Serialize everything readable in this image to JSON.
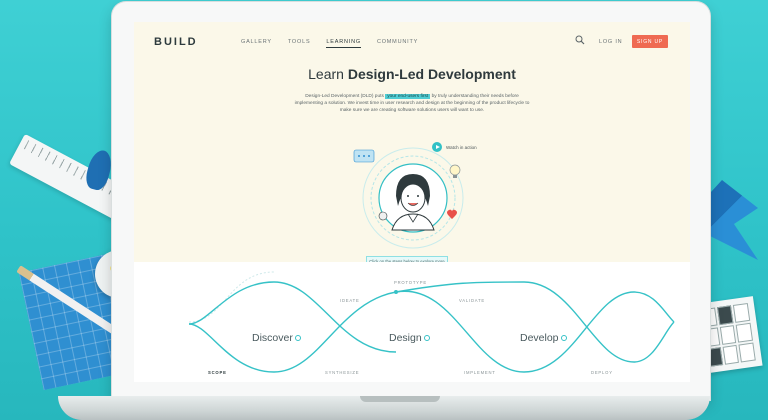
{
  "nav": {
    "logo": "BUILD",
    "links": [
      "GALLERY",
      "TOOLS",
      "LEARNING",
      "COMMUNITY"
    ],
    "active_link": "LEARNING",
    "login": "LOG IN",
    "signup": "SIGN UP"
  },
  "hero": {
    "title_prefix": "Learn ",
    "title_bold": "Design-Led Development",
    "desc_line1_a": "Design-Led Development (DLD) puts",
    "desc_highlight": "your end-users first",
    "desc_line1_b": "by truly understanding their needs before",
    "desc_line2": "implementing a solution. We invest time in user research and design at the beginning of the product",
    "desc_line3": "lifecycle to make sure we are creating software solutions users will want to use."
  },
  "watch": {
    "label": "Watch in action"
  },
  "cta": {
    "label": "Click on the steps below to explore more"
  },
  "phases": {
    "discover": "Discover",
    "design": "Design",
    "develop": "Develop"
  },
  "steps": {
    "scope": "SCOPE",
    "synthesize": "SYNTHESIZE",
    "ideate": "IDEATE",
    "prototype": "PROTOTYPE",
    "validate": "VALIDATE",
    "implement": "IMPLEMENT",
    "deploy": "DEPLOY"
  },
  "colors": {
    "accent": "#36c2c7",
    "signup": "#ef6a52",
    "screen_bg": "#fbf8e9",
    "page_bg": "#3fd0d4"
  },
  "icons": [
    "search-icon",
    "play-icon",
    "info-icon",
    "lightbulb-icon",
    "chat-icon",
    "heart-icon",
    "person-illustration"
  ]
}
